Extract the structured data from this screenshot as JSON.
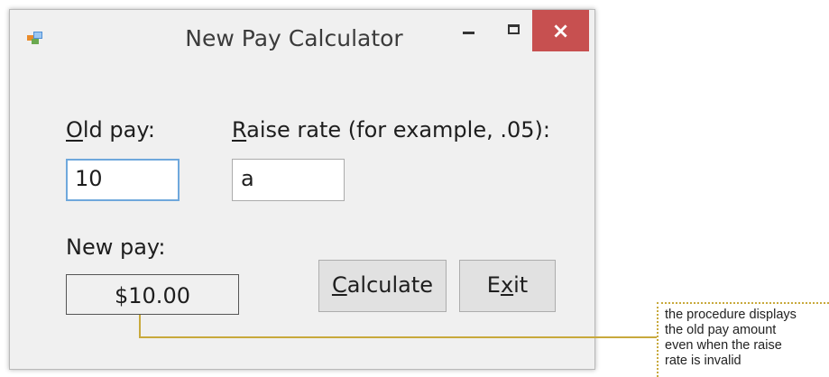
{
  "window": {
    "title": "New Pay Calculator",
    "controls": {
      "minimize": "minimize",
      "maximize": "maximize",
      "close": "×"
    }
  },
  "form": {
    "old_pay": {
      "mnemonic": "O",
      "rest": "ld pay:",
      "value": "10"
    },
    "raise_rate": {
      "mnemonic": "R",
      "rest": "aise rate (for example, .05):",
      "value": "a"
    },
    "new_pay": {
      "label": "New pay:",
      "value": "$10.00"
    },
    "calculate_button": {
      "mnemonic": "C",
      "rest": "alculate"
    },
    "exit_button": {
      "before": "E",
      "mnemonic": "x",
      "after": "it"
    }
  },
  "annotation": {
    "lines": [
      "the procedure displays",
      "the old pay amount",
      "even when the raise",
      "rate is invalid"
    ]
  },
  "colors": {
    "close_button": "#c75050",
    "callout_line": "#c8a93c",
    "focus_border": "#6fa8dc"
  }
}
